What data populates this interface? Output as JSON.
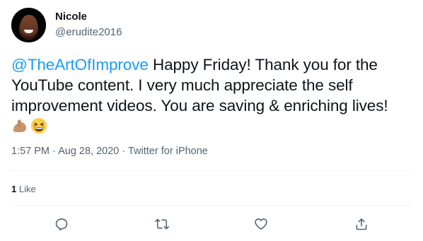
{
  "author": {
    "name": "Nicole",
    "handle": "@erudite2016"
  },
  "tweet": {
    "mention": "@TheArtOfImprove",
    "text": " Happy Friday! Thank you for the YouTube content. I very much appreciate the self improvement videos. You are saving & enriching lives!",
    "emojis": [
      "flexed-biceps",
      "grinning-squinting-face"
    ]
  },
  "meta": {
    "time": "1:57 PM",
    "separator": " · ",
    "date": "Aug 28, 2020",
    "client": "Twitter for iPhone"
  },
  "stats": {
    "like_count": "1",
    "like_label": "Like"
  },
  "actions": {
    "icons": [
      "reply-icon",
      "retweet-icon",
      "like-icon",
      "share-icon"
    ]
  },
  "colors": {
    "link": "#1d9bf0",
    "secondary_text": "#536471",
    "primary_text": "#0f1419",
    "divider": "#eff3f4"
  }
}
